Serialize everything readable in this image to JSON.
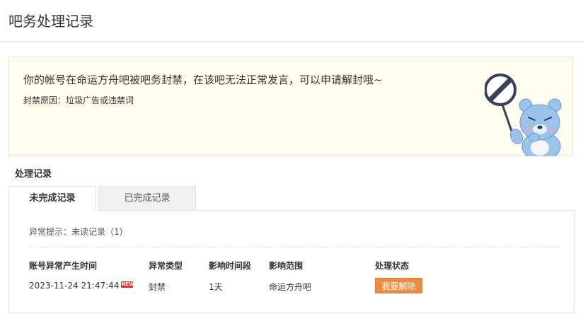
{
  "page": {
    "title": "吧务处理记录"
  },
  "notice": {
    "message": "你的帐号在命运方舟吧被吧务封禁，在该吧无法正常发言，可以申请解封哦~",
    "reason": "封禁原因：垃圾广告或违禁词"
  },
  "records": {
    "section_title": "处理记录",
    "tabs": [
      {
        "label": "未完成记录",
        "active": true
      },
      {
        "label": "已完成记录",
        "active": false
      }
    ],
    "abnormal_tip": "异常提示：未读记录（1）",
    "columns": [
      "账号异常产生时间",
      "异常类型",
      "影响时间段",
      "影响范围",
      "处理状态"
    ],
    "rows": [
      {
        "time": "2023-11-24 21:47:44",
        "badge": "NEW",
        "type": "封禁",
        "duration": "1天",
        "scope": "命运方舟吧",
        "action_label": "我要解除"
      }
    ]
  },
  "colors": {
    "notice_bg": "#fefdee",
    "accent_button": "#ed8c41",
    "badge": "#e53030",
    "bear": "#9cc3ec"
  },
  "icons": {
    "mascot": "bear-with-no-entry-sign"
  }
}
